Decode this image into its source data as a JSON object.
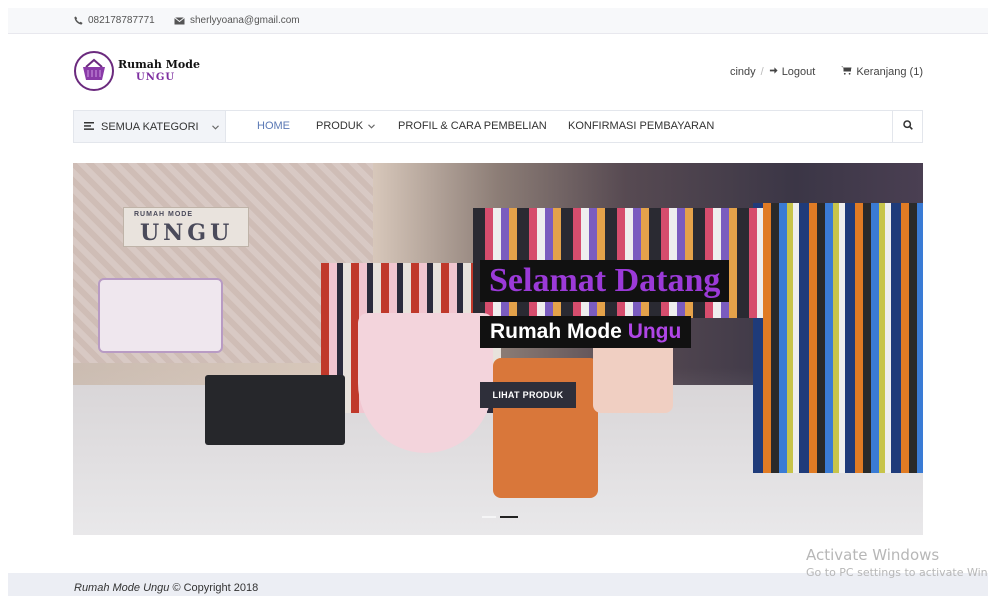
{
  "topbar": {
    "phone": "082178787771",
    "email": "sherlyyoana@gmail.com",
    "icons": [
      "phone-icon",
      "envelope-icon"
    ]
  },
  "logo": {
    "line1": "Rumah Mode",
    "line2": "UNGU"
  },
  "user": {
    "username": "cindy",
    "separator": "/",
    "logout_label": "Logout",
    "cart_label": "Keranjang (1)"
  },
  "nav": {
    "categories_label": "SEMUA KATEGORI",
    "items": [
      {
        "label": "HOME",
        "active": true
      },
      {
        "label": "PRODUK",
        "active": false
      },
      {
        "label": "PROFIL & CARA PEMBELIAN",
        "active": false
      },
      {
        "label": "KONFIRMASI PEMBAYARAN",
        "active": false
      }
    ]
  },
  "hero": {
    "title": "Selamat Datang",
    "subtitle_main": "Rumah Mode",
    "subtitle_accent": "Ungu",
    "button_label": "LIHAT PRODUK",
    "sign_small": "RUMAH MODE",
    "sign_big": "UNGU",
    "slides": 2,
    "active_slide": 2
  },
  "footer": {
    "brand": "Rumah Mode Ungu",
    "rest": "© Copyright 2018"
  },
  "watermark": {
    "line1": "Activate Windows",
    "line2": "Go to PC settings to activate Wind"
  },
  "colors": {
    "accent_purple": "#9b3ad8",
    "nav_active": "#5b79b5",
    "button_dark": "#2e2f3a"
  }
}
